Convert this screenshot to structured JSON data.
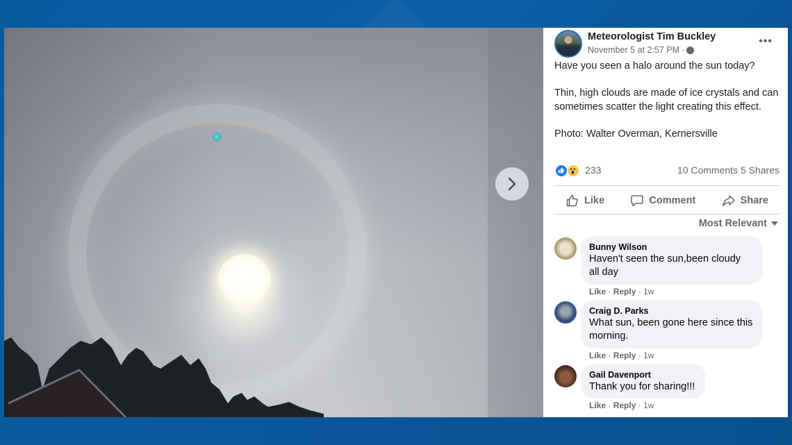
{
  "photo": {
    "alt": "Halo around the sun over trees and a rooftop",
    "next_label": "Next photo"
  },
  "post": {
    "author": "Meteorologist Tim Buckley",
    "date": "November 5 at 2:57 PM",
    "separator": "·",
    "privacy_icon": "globe-icon",
    "more_icon": "•••",
    "paragraphs": [
      "Have you seen a halo around the sun today?",
      "Thin, high clouds are made of ice crystals and can sometimes scatter the light creating this effect.",
      "Photo: Walter Overman, Kernersville"
    ]
  },
  "stats": {
    "reactions": [
      "like",
      "wow"
    ],
    "reaction_count": "233",
    "comments": "10 Comments",
    "shares": "5 Shares"
  },
  "actions": {
    "like": "Like",
    "comment": "Comment",
    "share": "Share"
  },
  "sort": {
    "label": "Most Relevant"
  },
  "comments": [
    {
      "name": "Bunny Wilson",
      "line1": "Haven't seen the sun,been cloudy",
      "line2": "all day",
      "like": "Like",
      "reply": "Reply",
      "time": "1w"
    },
    {
      "name": "Craig D. Parks",
      "line1": "What sun, been gone here since this",
      "line2": "morning.",
      "like": "Like",
      "reply": "Reply",
      "time": "1w"
    },
    {
      "name": "Gail Davenport",
      "line1": "Thank you for sharing!!!",
      "like": "Like",
      "reply": "Reply",
      "time": "1w"
    }
  ],
  "colors": {
    "frame_blue": "#0a5aa0",
    "facebook_blue": "#1877f2",
    "text_secondary": "#65676b",
    "bubble_gray": "#f0f2f5"
  }
}
